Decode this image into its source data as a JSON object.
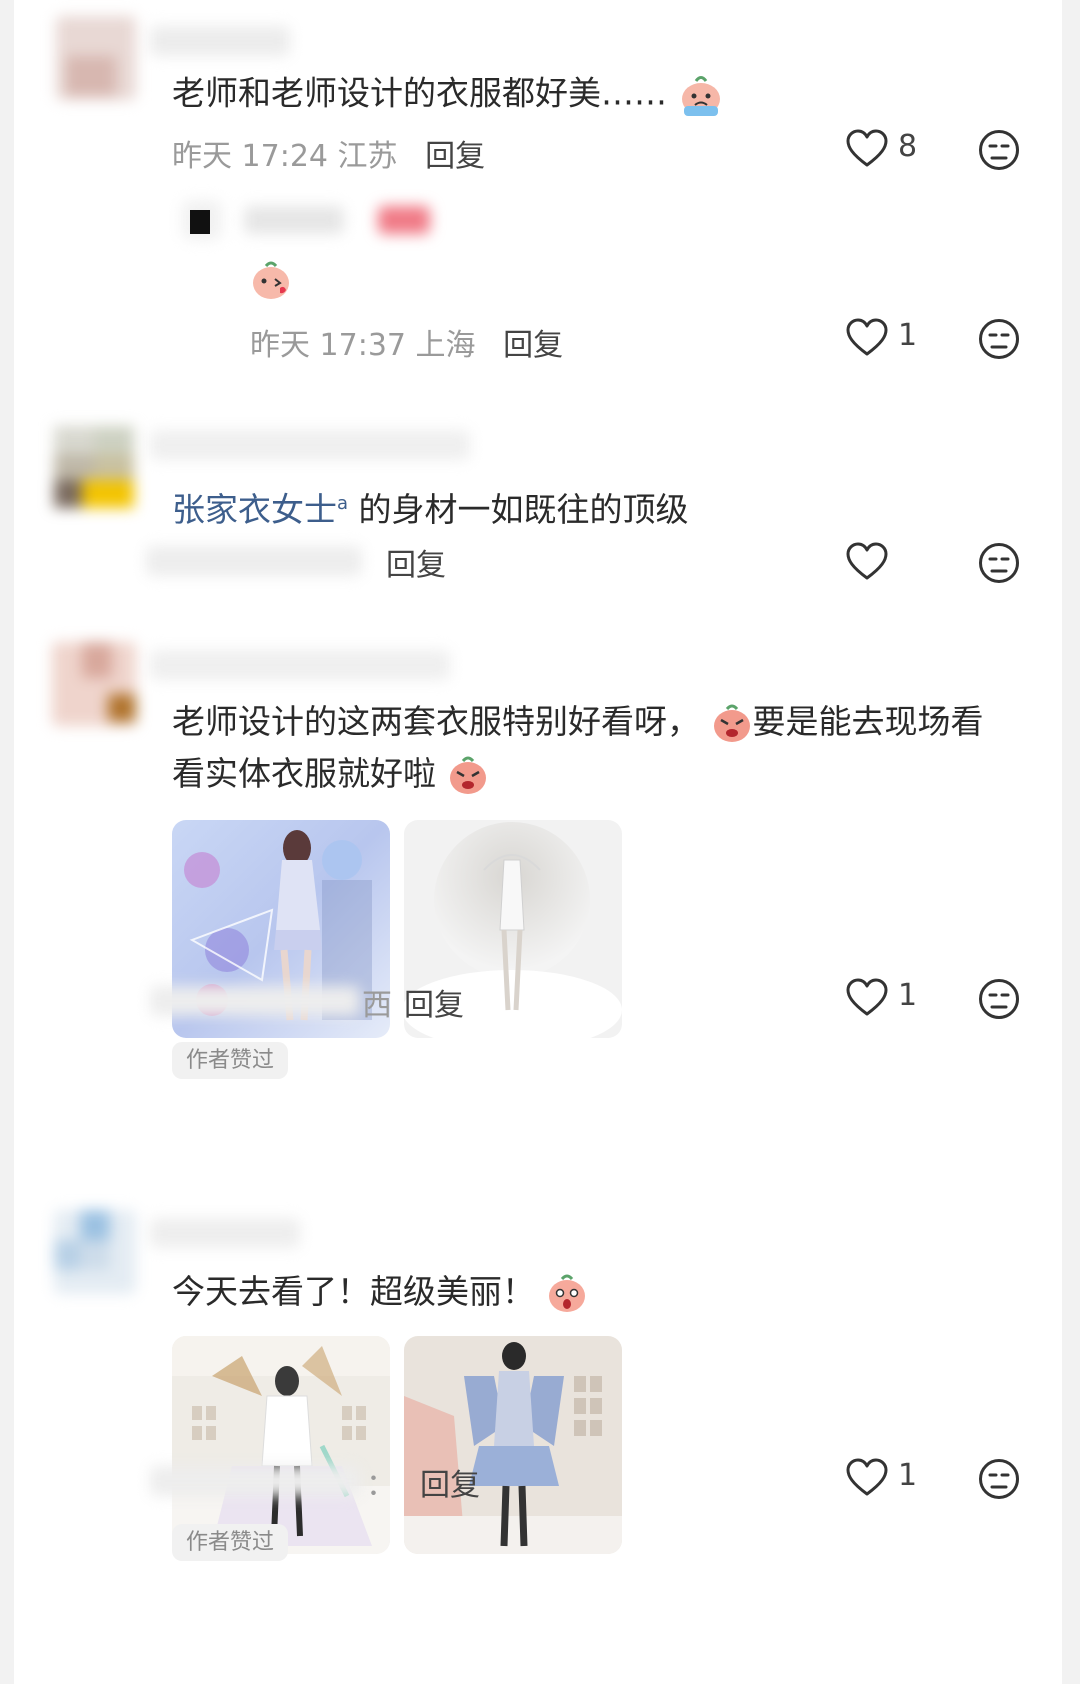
{
  "comments": [
    {
      "text": "老师和老师设计的衣服都好美……",
      "emoji_icon": "crying-peach-emoji",
      "time": "昨天 17:24",
      "location": "江苏",
      "reply_label": "回复",
      "likes": "8",
      "reply": {
        "emoji_icon": "kissing-peach-emoji",
        "time": "昨天 17:37",
        "location": "上海",
        "reply_label": "回复",
        "likes": "1"
      }
    },
    {
      "mention": "张家衣女士",
      "text": "的身材一如既往的顶级",
      "reply_label": "回复"
    },
    {
      "text_line1": "老师设计的这两套衣服特别好看呀，",
      "text_line1b": "要是能去现场看",
      "text_line2": "看实体衣服就好啦",
      "meta_tail": "西",
      "reply_label": "回复",
      "likes": "1",
      "badge": "作者赞过"
    },
    {
      "text": "今天去看了！超级美丽！",
      "emoji_icon": "surprised-peach-emoji",
      "meta_tail": "：",
      "reply_label": "回复",
      "likes": "1",
      "badge": "作者赞过"
    }
  ],
  "colors": {
    "mention": "#3d5e8c",
    "meta": "#9a9a9a",
    "background": "#ffffff"
  }
}
